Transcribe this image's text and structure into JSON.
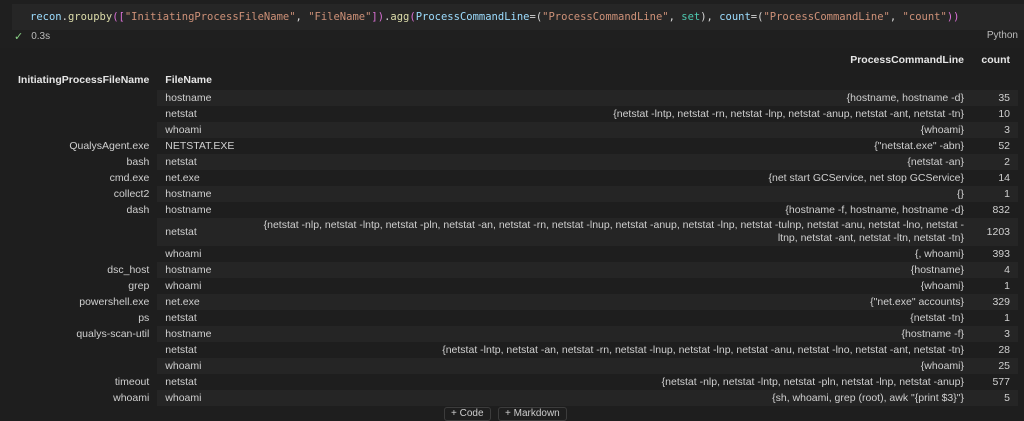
{
  "cell": {
    "code": {
      "p1": "recon",
      "p2": ".",
      "p3": "groupby",
      "p4": "([",
      "p5": "\"InitiatingProcessFileName\"",
      "p6": ", ",
      "p7": "\"FileName\"",
      "p8": "])",
      "p9": ".",
      "p10": "agg",
      "p11": "(",
      "p12": "ProcessCommandLine",
      "p13": "=(",
      "p14": "\"ProcessCommandLine\"",
      "p15": ", ",
      "p16": "set",
      "p17": "), ",
      "p18": "count",
      "p19": "=(",
      "p20": "\"ProcessCommandLine\"",
      "p21": ", ",
      "p22": "\"count\"",
      "p23": "))"
    },
    "status_time": "0.3s",
    "language": "Python"
  },
  "table": {
    "col_header_row1": [
      "",
      "",
      "ProcessCommandLine",
      "count"
    ],
    "index_names": [
      "InitiatingProcessFileName",
      "FileName"
    ],
    "rows": [
      {
        "i0": "",
        "i1": "hostname",
        "cmd": "{hostname, hostname -d}",
        "count": "35"
      },
      {
        "i0": "",
        "i1": "netstat",
        "cmd": "{netstat -lntp, netstat -rn, netstat -lnp, netstat -anup, netstat -ant, netstat -tn}",
        "count": "10"
      },
      {
        "i0": "",
        "i1": "whoami",
        "cmd": "{whoami}",
        "count": "3"
      },
      {
        "i0": "QualysAgent.exe",
        "i1": "NETSTAT.EXE",
        "cmd": "{\"netstat.exe\" -abn}",
        "count": "52"
      },
      {
        "i0": "bash",
        "i1": "netstat",
        "cmd": "{netstat -an}",
        "count": "2"
      },
      {
        "i0": "cmd.exe",
        "i1": "net.exe",
        "cmd": "{net start GCService, net stop GCService}",
        "count": "14"
      },
      {
        "i0": "collect2",
        "i1": "hostname",
        "cmd": "{}",
        "count": "1"
      },
      {
        "i0": "dash",
        "i1": "hostname",
        "cmd": "{hostname -f, hostname, hostname -d}",
        "count": "832"
      },
      {
        "i0": "",
        "i1": "netstat",
        "cmd": "{netstat -nlp, netstat -lntp, netstat -pln, netstat -an, netstat -rn, netstat -lnup, netstat -anup, netstat -lnp, netstat -tulnp, netstat -anu, netstat -lno, netstat -ltnp, netstat -ant, netstat -ltn, netstat -tn}",
        "count": "1203"
      },
      {
        "i0": "",
        "i1": "whoami",
        "cmd": "{, whoami}",
        "count": "393"
      },
      {
        "i0": "dsc_host",
        "i1": "hostname",
        "cmd": "{hostname}",
        "count": "4"
      },
      {
        "i0": "grep",
        "i1": "whoami",
        "cmd": "{whoami}",
        "count": "1"
      },
      {
        "i0": "powershell.exe",
        "i1": "net.exe",
        "cmd": "{\"net.exe\" accounts}",
        "count": "329"
      },
      {
        "i0": "ps",
        "i1": "netstat",
        "cmd": "{netstat -tn}",
        "count": "1"
      },
      {
        "i0": "qualys-scan-util",
        "i1": "hostname",
        "cmd": "{hostname -f}",
        "count": "3"
      },
      {
        "i0": "",
        "i1": "netstat",
        "cmd": "{netstat -lntp, netstat -an, netstat -rn, netstat -lnup, netstat -lnp, netstat -anu, netstat -lno, netstat -ant, netstat -tn}",
        "count": "28"
      },
      {
        "i0": "",
        "i1": "whoami",
        "cmd": "{whoami}",
        "count": "25"
      },
      {
        "i0": "timeout",
        "i1": "netstat",
        "cmd": "{netstat -nlp, netstat -lntp, netstat -pln, netstat -lnp, netstat -anup}",
        "count": "577"
      },
      {
        "i0": "whoami",
        "i1": "whoami",
        "cmd": "{sh, whoami, grep (root), awk \"{print $3}\"}",
        "count": "5"
      }
    ]
  },
  "buttons": {
    "code": "+ Code",
    "markdown": "+ Markdown"
  },
  "colors": {
    "background": "#1e1e1e",
    "stripe": "#252525",
    "check": "#89d185",
    "string": "#ce9178",
    "variable": "#9cdcfe",
    "function": "#dcdcaa"
  }
}
